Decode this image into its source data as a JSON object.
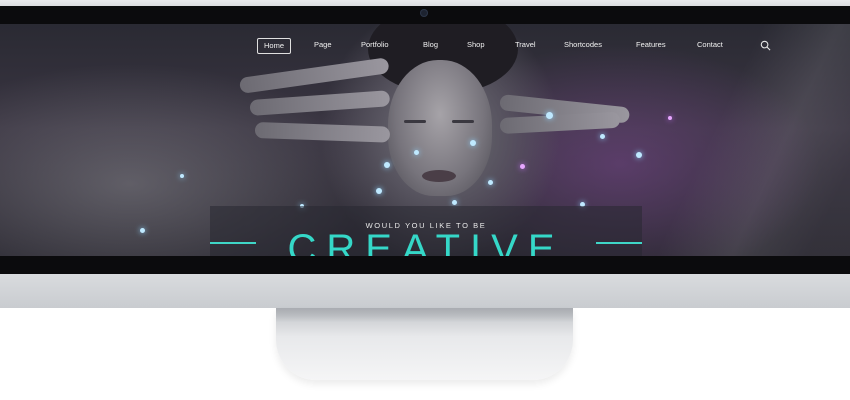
{
  "nav": {
    "items": [
      {
        "label": "Home",
        "active": true
      },
      {
        "label": "Page",
        "active": false
      },
      {
        "label": "Portfolio",
        "active": false
      },
      {
        "label": "Blog",
        "active": false
      },
      {
        "label": "Shop",
        "active": false
      },
      {
        "label": "Travel",
        "active": false
      },
      {
        "label": "Shortcodes",
        "active": false
      },
      {
        "label": "Features",
        "active": false
      },
      {
        "label": "Contact",
        "active": false
      }
    ],
    "search_icon": "search-icon"
  },
  "hero": {
    "tagline": "WOULD YOU LIKE TO BE",
    "headline": "CREATIVE"
  },
  "colors": {
    "accent": "#35d8c8",
    "bezel": "#0b0b0d",
    "monitor_frame": "#d4d6d9"
  }
}
